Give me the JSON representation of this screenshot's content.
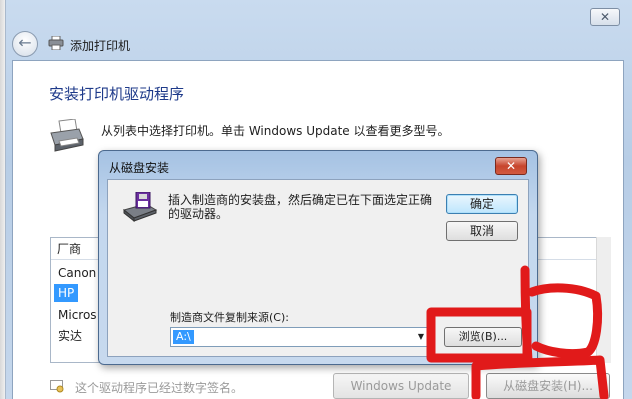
{
  "window": {
    "title": "添加打印机",
    "close_glyph": "✕",
    "back_glyph": "←"
  },
  "main": {
    "heading": "安装打印机驱动程序",
    "instruction": "从列表中选择打印机。单击 Windows Update 以查看更多型号。",
    "list": {
      "header": "厂商",
      "items": [
        "Canon",
        "HP",
        "Micros",
        "实达"
      ],
      "selected_index": 1
    },
    "signature_text": "这个驱动程序已经过数字签名。",
    "buttons": {
      "windows_update": "Windows Update",
      "from_disk": "从磁盘安装(H)..."
    }
  },
  "dialog": {
    "title": "从磁盘安装",
    "close_glyph": "✕",
    "message": "插入制造商的安装盘，然后确定已在下面选定正确的驱动器。",
    "ok_label": "确定",
    "cancel_label": "取消",
    "source_label": "制造商文件复制来源(C):",
    "source_value": "A:\\",
    "dropdown_glyph": "▼",
    "browse_label": "浏览(B)..."
  },
  "colors": {
    "accent": "#1e3a8a",
    "selection": "#3399ff",
    "annotation": "#e11a1a",
    "dialog_close": "#c7452d"
  },
  "icons": [
    "back-arrow-icon",
    "printer-icon",
    "floppy-disk-icon",
    "certificate-icon"
  ]
}
